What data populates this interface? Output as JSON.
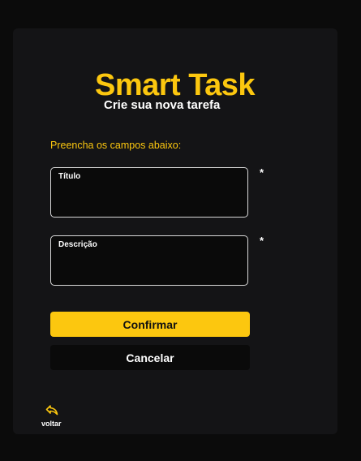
{
  "brand": {
    "title": "Smart Task",
    "subtitle": "Crie sua nova tarefa",
    "accent_color": "#fcc70f"
  },
  "form": {
    "instructions": "Preencha os campos abaixo:",
    "fields": [
      {
        "label": "Título",
        "value": "",
        "required_marker": "*"
      },
      {
        "label": "Descrição",
        "value": "",
        "required_marker": "*"
      }
    ]
  },
  "actions": {
    "confirm_label": "Confirmar",
    "cancel_label": "Cancelar"
  },
  "back": {
    "label": "voltar",
    "icon": "back-arrow-icon"
  }
}
